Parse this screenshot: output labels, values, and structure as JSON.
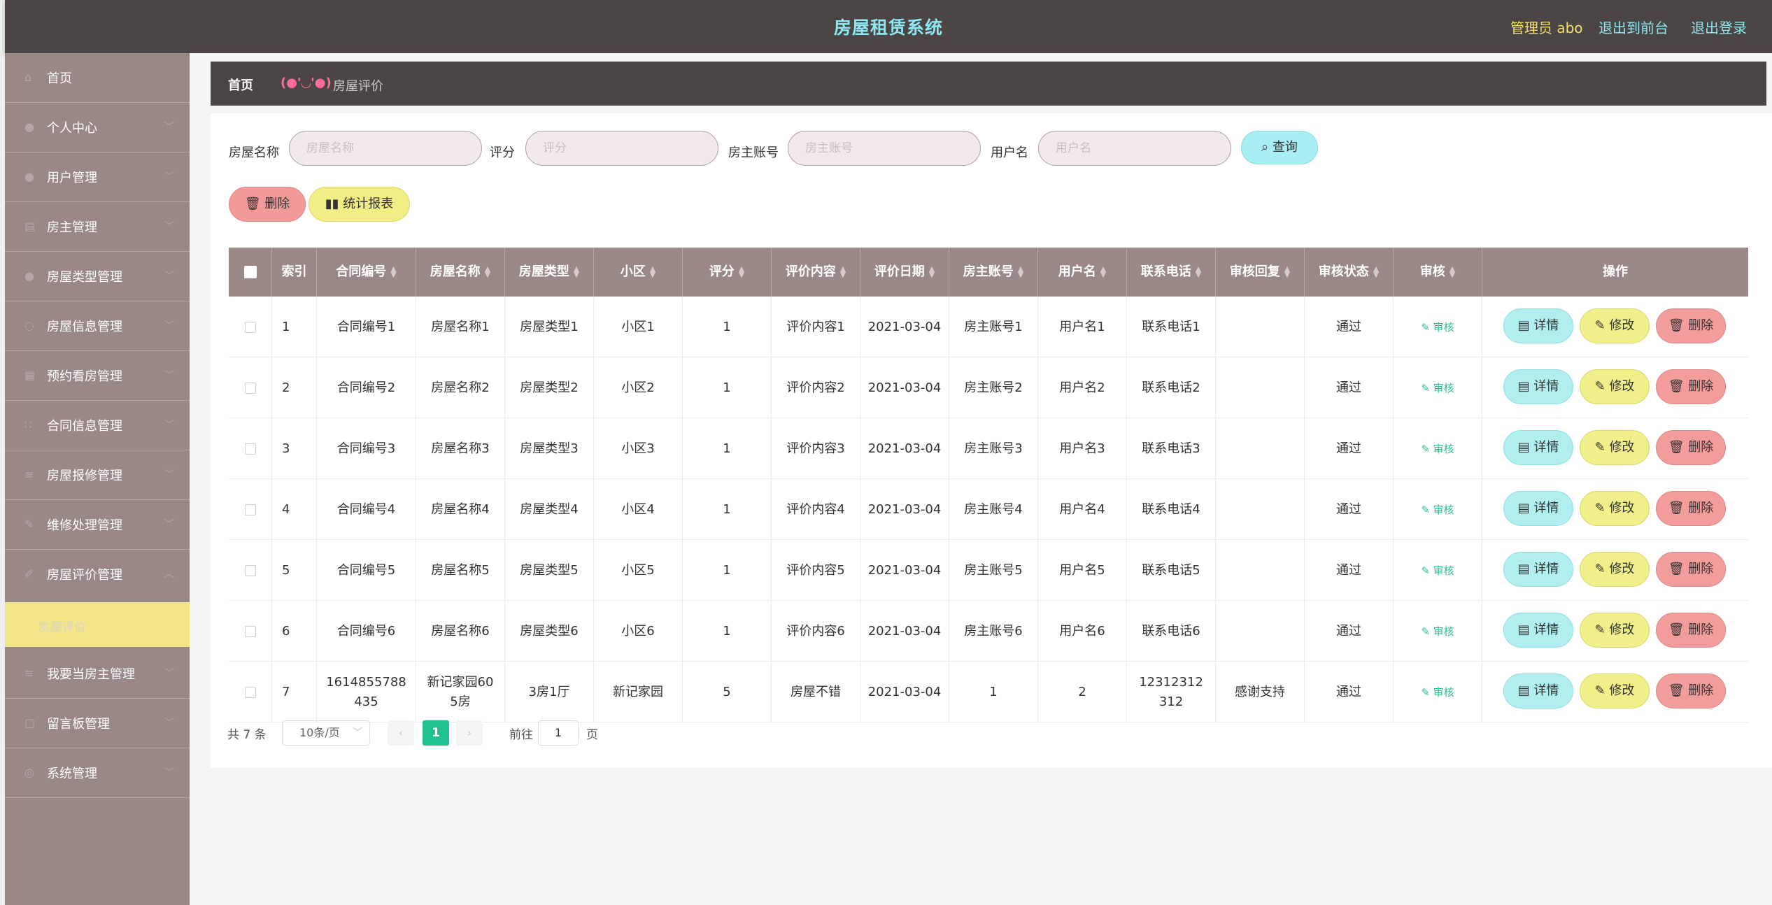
{
  "header": {
    "title": "房屋租赁系统",
    "admin": "管理员 abo",
    "to_front": "退出到前台",
    "logout": "退出登录"
  },
  "sidebar": {
    "items": [
      {
        "label": "首页",
        "icon": "home-icon"
      },
      {
        "label": "个人中心",
        "icon": "user-icon"
      },
      {
        "label": "用户管理",
        "icon": "user-icon"
      },
      {
        "label": "房主管理",
        "icon": "house-icon"
      },
      {
        "label": "房屋类型管理",
        "icon": "user-icon"
      },
      {
        "label": "房屋信息管理",
        "icon": "info-icon"
      },
      {
        "label": "预约看房管理",
        "icon": "calendar-icon"
      },
      {
        "label": "合同信息管理",
        "icon": "grid-icon"
      },
      {
        "label": "房屋报修管理",
        "icon": "list-icon"
      },
      {
        "label": "维修处理管理",
        "icon": "wrench-icon"
      },
      {
        "label": "房屋评价管理",
        "icon": "comment-icon"
      },
      {
        "label": "我要当房主管理",
        "icon": "list-icon"
      },
      {
        "label": "留言板管理",
        "icon": "message-icon"
      },
      {
        "label": "系统管理",
        "icon": "settings-icon"
      }
    ],
    "active_sub": "房屋评价"
  },
  "breadcrumb": {
    "home": "首页",
    "emoticon": "(●'◡'●)",
    "current": "房屋评价"
  },
  "search": {
    "house_name_label": "房屋名称",
    "house_name_placeholder": "房屋名称",
    "score_label": "评分",
    "score_placeholder": "评分",
    "owner_account_label": "房主账号",
    "owner_account_placeholder": "房主账号",
    "username_label": "用户名",
    "username_placeholder": "用户名",
    "query_button": "查询"
  },
  "actions": {
    "delete": "删除",
    "report": "统计报表"
  },
  "table": {
    "columns": [
      "索引",
      "合同编号",
      "房屋名称",
      "房屋类型",
      "小区",
      "评分",
      "评价内容",
      "评价日期",
      "房主账号",
      "用户名",
      "联系电话",
      "审核回复",
      "审核状态",
      "审核",
      "操作"
    ],
    "rows": [
      {
        "index": "1",
        "contract": "合同编号1",
        "house": "房屋名称1",
        "type": "房屋类型1",
        "community": "小区1",
        "score": "1",
        "content": "评价内容1",
        "date": "2021-03-04",
        "owner": "房主账号1",
        "user": "用户名1",
        "phone": "联系电话1",
        "reply": "",
        "status": "通过",
        "audit": "审核"
      },
      {
        "index": "2",
        "contract": "合同编号2",
        "house": "房屋名称2",
        "type": "房屋类型2",
        "community": "小区2",
        "score": "1",
        "content": "评价内容2",
        "date": "2021-03-04",
        "owner": "房主账号2",
        "user": "用户名2",
        "phone": "联系电话2",
        "reply": "",
        "status": "通过",
        "audit": "审核"
      },
      {
        "index": "3",
        "contract": "合同编号3",
        "house": "房屋名称3",
        "type": "房屋类型3",
        "community": "小区3",
        "score": "1",
        "content": "评价内容3",
        "date": "2021-03-04",
        "owner": "房主账号3",
        "user": "用户名3",
        "phone": "联系电话3",
        "reply": "",
        "status": "通过",
        "audit": "审核"
      },
      {
        "index": "4",
        "contract": "合同编号4",
        "house": "房屋名称4",
        "type": "房屋类型4",
        "community": "小区4",
        "score": "1",
        "content": "评价内容4",
        "date": "2021-03-04",
        "owner": "房主账号4",
        "user": "用户名4",
        "phone": "联系电话4",
        "reply": "",
        "status": "通过",
        "audit": "审核"
      },
      {
        "index": "5",
        "contract": "合同编号5",
        "house": "房屋名称5",
        "type": "房屋类型5",
        "community": "小区5",
        "score": "1",
        "content": "评价内容5",
        "date": "2021-03-04",
        "owner": "房主账号5",
        "user": "用户名5",
        "phone": "联系电话5",
        "reply": "",
        "status": "通过",
        "audit": "审核"
      },
      {
        "index": "6",
        "contract": "合同编号6",
        "house": "房屋名称6",
        "type": "房屋类型6",
        "community": "小区6",
        "score": "1",
        "content": "评价内容6",
        "date": "2021-03-04",
        "owner": "房主账号6",
        "user": "用户名6",
        "phone": "联系电话6",
        "reply": "",
        "status": "通过",
        "audit": "审核"
      },
      {
        "index": "7",
        "contract": "1614855788435",
        "house": "新记家园605房",
        "type": "3房1厅",
        "community": "新记家园",
        "score": "5",
        "content": "房屋不错",
        "date": "2021-03-04",
        "owner": "1",
        "user": "2",
        "phone": "12312312312",
        "reply": "感谢支持",
        "status": "通过",
        "audit": "审核"
      }
    ],
    "op_detail": "详情",
    "op_edit": "修改",
    "op_delete": "删除"
  },
  "pagination": {
    "total": "共 7 条",
    "page_size": "10条/页",
    "current_page": "1",
    "goto_label": "前往",
    "goto_value": "1",
    "page_suffix": "页"
  },
  "colors": {
    "header_bg": "#4b4546",
    "sidebar_bg": "#9a8887",
    "title_color": "#8ee8f2",
    "admin_color": "#f5df6b",
    "active_sub_bg": "#f2e588",
    "pager_active": "#1fc18e"
  }
}
